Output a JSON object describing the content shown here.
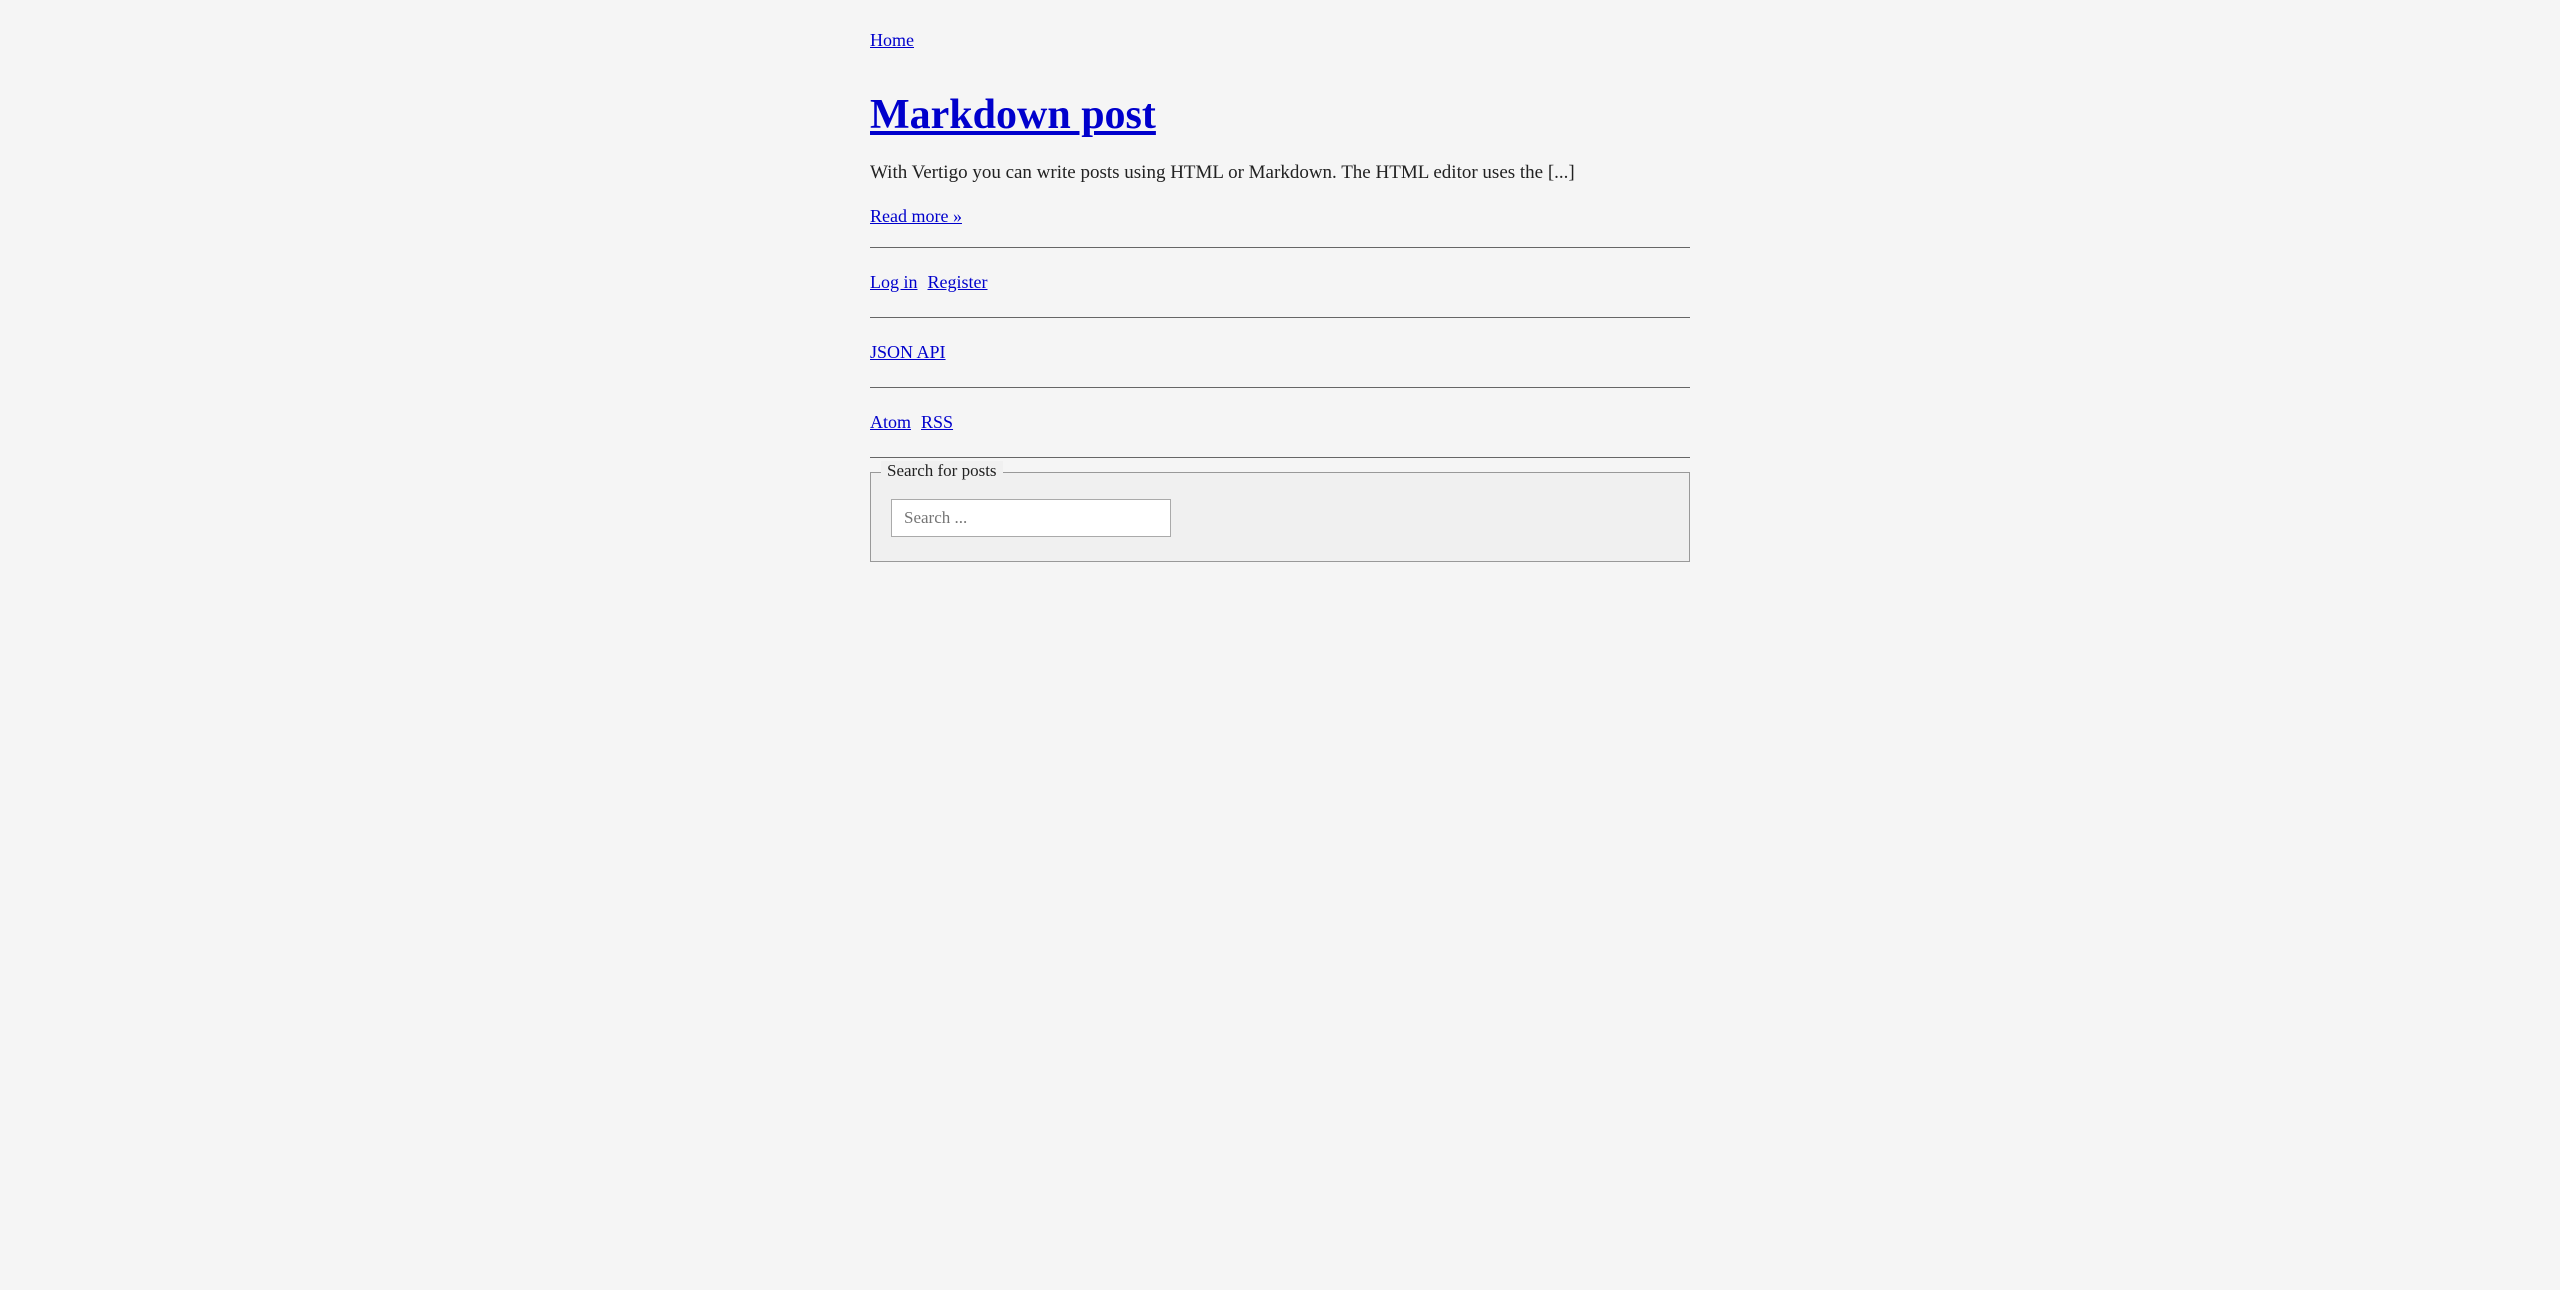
{
  "breadcrumb": {
    "home_label": "Home",
    "home_href": "/"
  },
  "post": {
    "title": "Markdown post",
    "title_href": "/markdown-post",
    "excerpt": "With Vertigo you can write posts using HTML or Markdown. The HTML editor uses the [...]",
    "read_more_label": "Read more »",
    "read_more_href": "/markdown-post"
  },
  "nav": {
    "login_label": "Log in",
    "login_href": "/login",
    "register_label": "Register",
    "register_href": "/register",
    "json_api_label": "JSON API",
    "json_api_href": "/api",
    "atom_label": "Atom",
    "atom_href": "/atom",
    "rss_label": "RSS",
    "rss_href": "/rss"
  },
  "search": {
    "legend": "Search for posts",
    "placeholder": "Search ..."
  }
}
